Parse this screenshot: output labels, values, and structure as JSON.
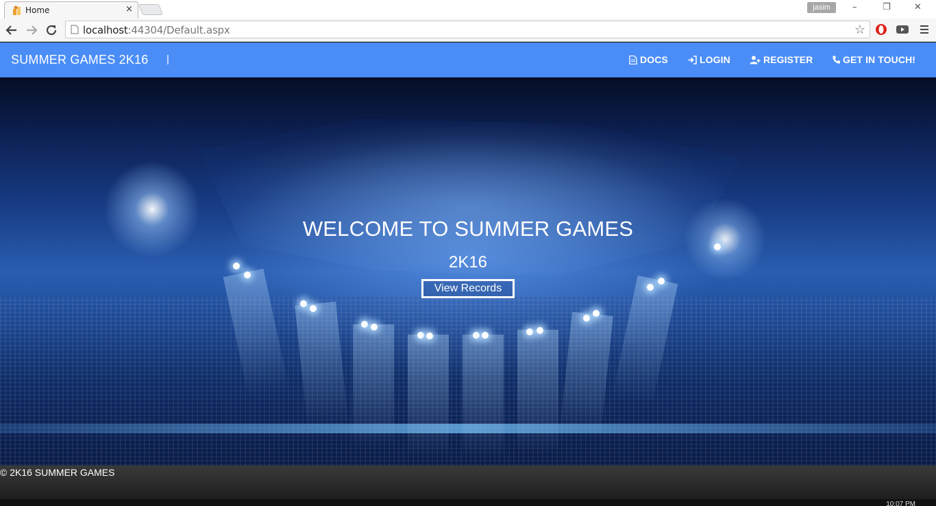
{
  "browser": {
    "tab_title": "Home",
    "tab_close": "×",
    "profile_name": "jasim",
    "url_host": "localhost",
    "url_rest": ":44304/Default.aspx",
    "window_controls": [
      "–",
      "❐",
      "✕"
    ]
  },
  "navbar": {
    "brand": "SUMMER GAMES 2K16",
    "separator": "|",
    "links": [
      {
        "label": "DOCS",
        "icon": "file-icon"
      },
      {
        "label": "LOGIN",
        "icon": "sign-in-icon"
      },
      {
        "label": "REGISTER",
        "icon": "user-plus-icon"
      },
      {
        "label": "GET IN TOUCH!",
        "icon": "phone-icon"
      }
    ],
    "background_color": "#4a8df7"
  },
  "hero": {
    "title": "WELCOME TO SUMMER GAMES",
    "subtitle": "2K16",
    "button_label": "View Records"
  },
  "footer": {
    "copyright": "© 2K16 SUMMER GAMES"
  },
  "taskbar": {
    "clock": "10:07 PM"
  }
}
